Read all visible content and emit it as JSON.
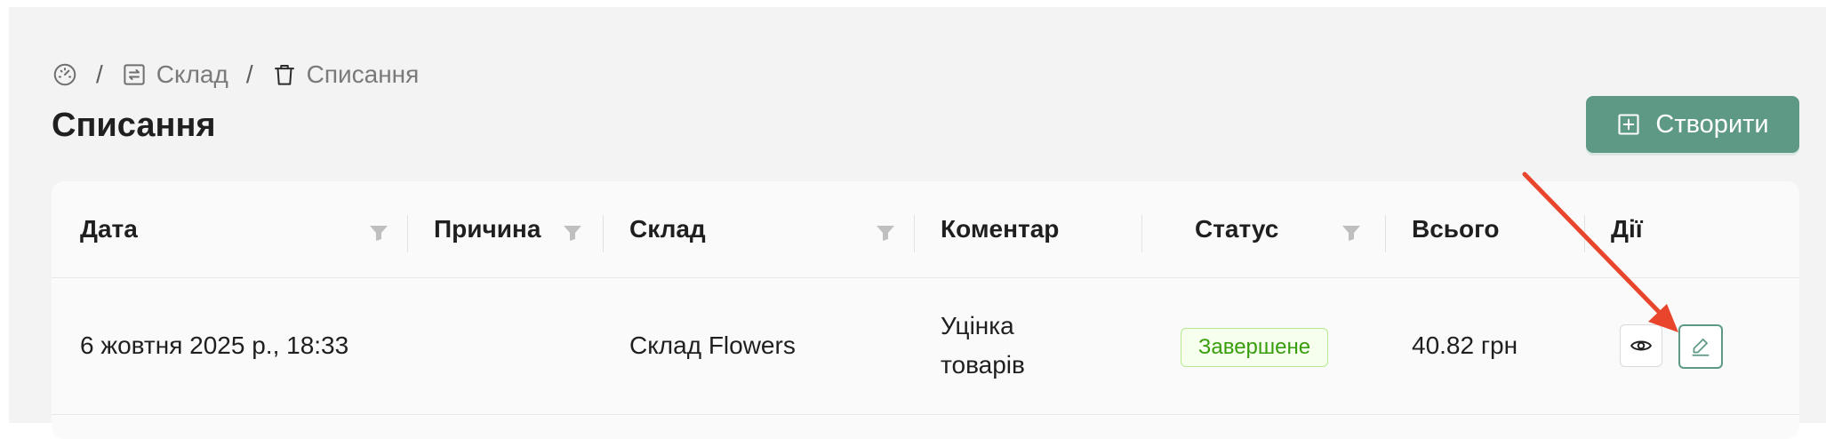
{
  "breadcrumb": {
    "items": [
      {
        "icon": "dashboard-icon",
        "label": ""
      },
      {
        "icon": "warehouse-icon",
        "label": "Склад"
      },
      {
        "icon": "trash-icon",
        "label": "Списання"
      }
    ],
    "separator": "/"
  },
  "page": {
    "title": "Списання"
  },
  "create_button": {
    "label": "Створити",
    "icon": "plus-square-icon"
  },
  "table": {
    "columns": [
      {
        "label": "Дата",
        "filter": true
      },
      {
        "label": "Причина",
        "filter": true
      },
      {
        "label": "Склад",
        "filter": true
      },
      {
        "label": "Коментар",
        "filter": false
      },
      {
        "label": "Статус",
        "filter": true
      },
      {
        "label": "Всього",
        "filter": false
      },
      {
        "label": "Дії",
        "filter": false
      }
    ],
    "rows": [
      {
        "date": "6 жовтня 2025 р., 18:33",
        "reason": "",
        "warehouse": "Склад Flowers",
        "comment_line1": "Уцінка",
        "comment_line2": "товарів",
        "status": "Завершене",
        "total": "40.82 грн",
        "actions": [
          "eye-icon",
          "edit-icon"
        ]
      }
    ]
  },
  "colors": {
    "accent": "#5d9985",
    "status_success_text": "#389e0d",
    "status_success_bg": "#f6ffed",
    "status_success_border": "#b7eb8f",
    "annotation_arrow": "#e8452c"
  }
}
